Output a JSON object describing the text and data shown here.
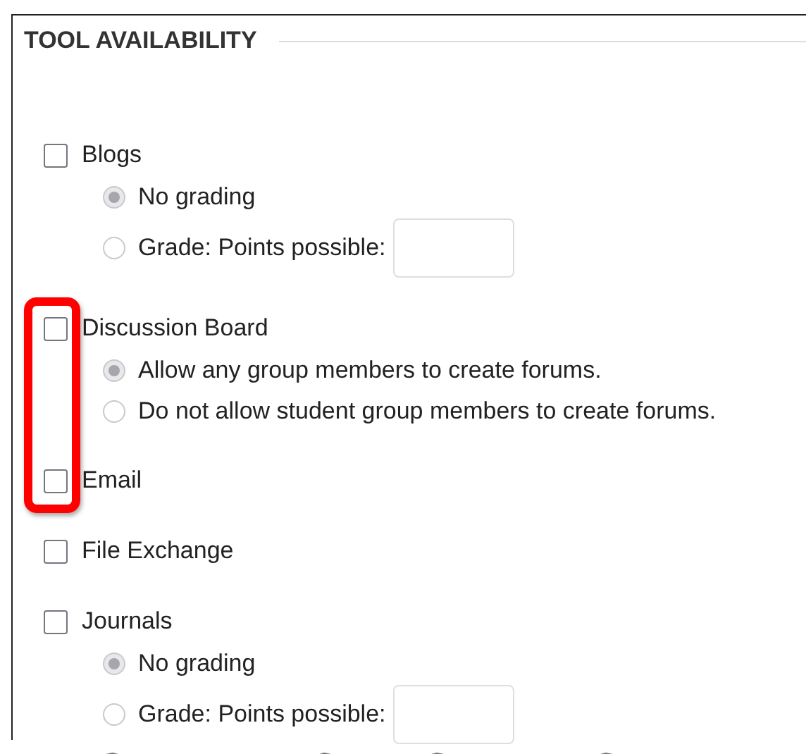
{
  "section": {
    "title": "TOOL AVAILABILITY"
  },
  "tools": [
    {
      "label": "Blogs",
      "checked": false,
      "highlighted": false,
      "options": [
        {
          "kind": "radio",
          "label": "No grading",
          "selected": true
        },
        {
          "kind": "points",
          "label": "Grade: Points possible:",
          "selected": false
        }
      ]
    },
    {
      "label": "Discussion Board",
      "checked": false,
      "highlighted": true,
      "options": [
        {
          "kind": "radio",
          "label": "Allow any group members to create forums.",
          "selected": true
        },
        {
          "kind": "radio",
          "label": "Do not allow student group members to create forums.",
          "selected": false
        }
      ]
    },
    {
      "label": "Email",
      "checked": false,
      "highlighted": true
    },
    {
      "label": "File Exchange",
      "checked": false,
      "highlighted": false
    },
    {
      "label": "Journals",
      "checked": false,
      "highlighted": false,
      "options": [
        {
          "kind": "radio",
          "label": "No grading",
          "selected": true
        },
        {
          "kind": "points",
          "label": "Grade: Points possible:",
          "selected": false
        }
      ]
    }
  ]
}
